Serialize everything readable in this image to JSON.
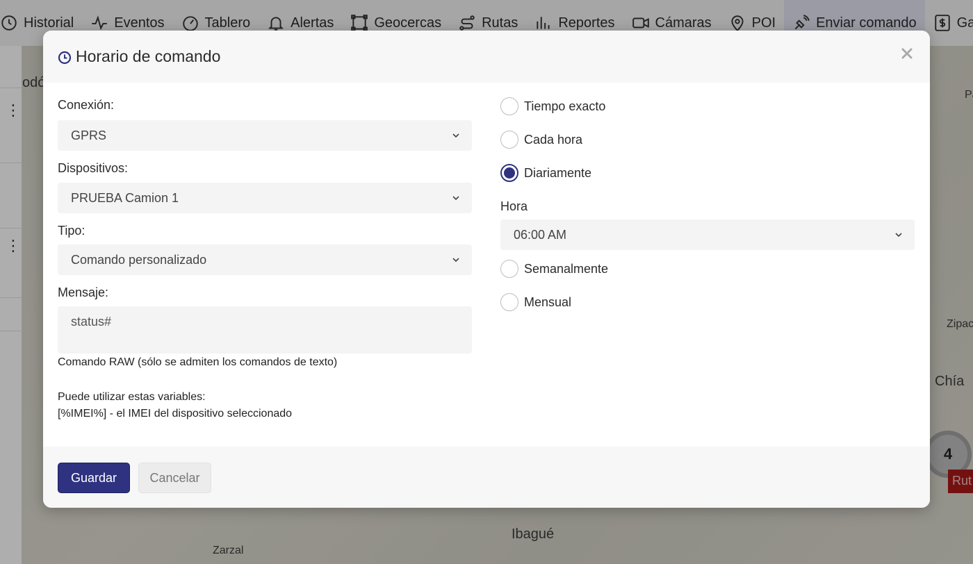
{
  "topnav": {
    "items": [
      {
        "label": "Historial",
        "icon": "history-icon"
      },
      {
        "label": "Eventos",
        "icon": "pulse-icon"
      },
      {
        "label": "Tablero",
        "icon": "gauge-icon"
      },
      {
        "label": "Alertas",
        "icon": "bell-icon"
      },
      {
        "label": "Geocercas",
        "icon": "geofence-icon"
      },
      {
        "label": "Rutas",
        "icon": "route-icon"
      },
      {
        "label": "Reportes",
        "icon": "bar-chart-icon"
      },
      {
        "label": "Cámaras",
        "icon": "video-camera-icon"
      },
      {
        "label": "POI",
        "icon": "map-pin-icon"
      },
      {
        "label": "Enviar comando",
        "icon": "satellite-icon"
      },
      {
        "label": "Gastos",
        "icon": "dollar-icon"
      }
    ]
  },
  "map": {
    "labels": [
      "Chía",
      "Ibagué",
      "Zarzal",
      "Zipac",
      "Pa",
      "odó"
    ],
    "cluster_count": "4",
    "route_tag": "Rut"
  },
  "modal": {
    "title": "Horario de comando",
    "close_symbol": "×",
    "connection": {
      "label": "Conexión:",
      "value": "GPRS"
    },
    "devices": {
      "label": "Dispositivos:",
      "value": "PRUEBA Camion 1"
    },
    "type": {
      "label": "Tipo:",
      "value": "Comando personalizado"
    },
    "message": {
      "label": "Mensaje:",
      "value": "status#"
    },
    "help_raw": "Comando RAW (sólo se admiten los comandos de texto)",
    "help_vars_title": "Puede utilizar estas variables:",
    "help_vars_imei": "[%IMEI%] - el IMEI del dispositivo seleccionado",
    "schedule": {
      "options": [
        {
          "label": "Tiempo exacto",
          "checked": false
        },
        {
          "label": "Cada hora",
          "checked": false
        },
        {
          "label": "Diariamente",
          "checked": true
        },
        {
          "label": "Semanalmente",
          "checked": false
        },
        {
          "label": "Mensual",
          "checked": false
        }
      ],
      "hour_label": "Hora",
      "hour_value": "06:00 AM"
    },
    "buttons": {
      "save": "Guardar",
      "cancel": "Cancelar"
    }
  },
  "colors": {
    "primary": "#2e3280",
    "header_bg": "#f7f7f7",
    "input_bg": "#f4f4f4"
  }
}
